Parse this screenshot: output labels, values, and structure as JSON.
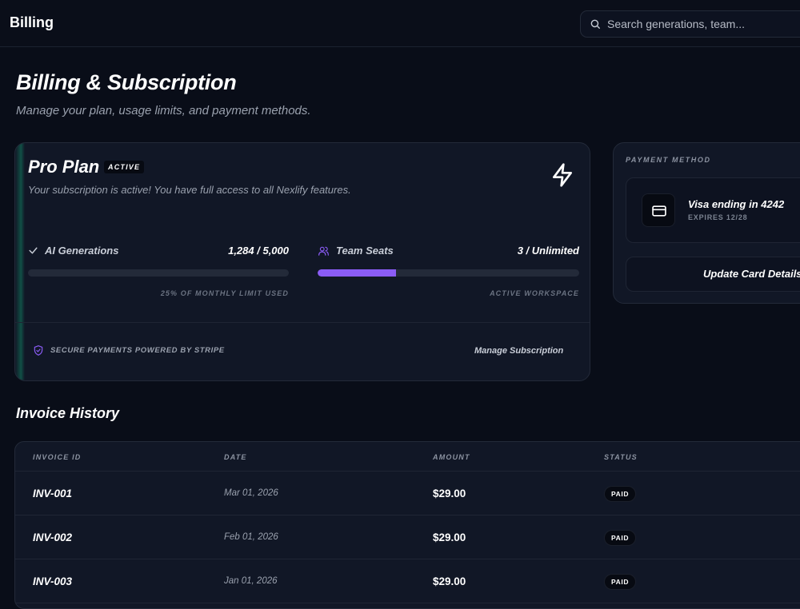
{
  "header": {
    "title": "Billing",
    "search_placeholder": "Search generations, team..."
  },
  "page": {
    "title": "Billing & Subscription",
    "subtitle": "Manage your plan, usage limits, and payment methods."
  },
  "plan": {
    "name": "Pro Plan",
    "badge": "ACTIVE",
    "description": "Your subscription is active! You have full access to all Nexlify features.",
    "icon": "bolt-icon",
    "usage": [
      {
        "label": "AI Generations",
        "icon": "check-icon",
        "value": "1,284 / 5,000",
        "progress": 0.0,
        "caption": "25% OF MONTHLY LIMIT USED"
      },
      {
        "label": "Team Seats",
        "icon": "users-icon",
        "value": "3 / Unlimited",
        "progress": 0.3,
        "caption": "ACTIVE WORKSPACE",
        "color": "#8b5cf6"
      }
    ],
    "secure_text": "SECURE PAYMENTS POWERED BY STRIPE",
    "manage_label": "Manage Subscription"
  },
  "payment": {
    "title": "PAYMENT METHOD",
    "card_name": "Visa ending in 4242",
    "card_expiry": "EXPIRES 12/28",
    "update_label": "Update Card Details"
  },
  "invoices": {
    "title": "Invoice History",
    "columns": [
      "INVOICE ID",
      "DATE",
      "AMOUNT",
      "STATUS"
    ],
    "rows": [
      {
        "id": "INV-001",
        "date": "Mar 01, 2026",
        "amount": "$29.00",
        "status": "PAID"
      },
      {
        "id": "INV-002",
        "date": "Feb 01, 2026",
        "amount": "$29.00",
        "status": "PAID"
      },
      {
        "id": "INV-003",
        "date": "Jan 01, 2026",
        "amount": "$29.00",
        "status": "PAID"
      }
    ]
  },
  "colors": {
    "background": "#090d18",
    "card": "#111726",
    "accent_purple": "#8b5cf6",
    "accent_green": "#10b981"
  }
}
